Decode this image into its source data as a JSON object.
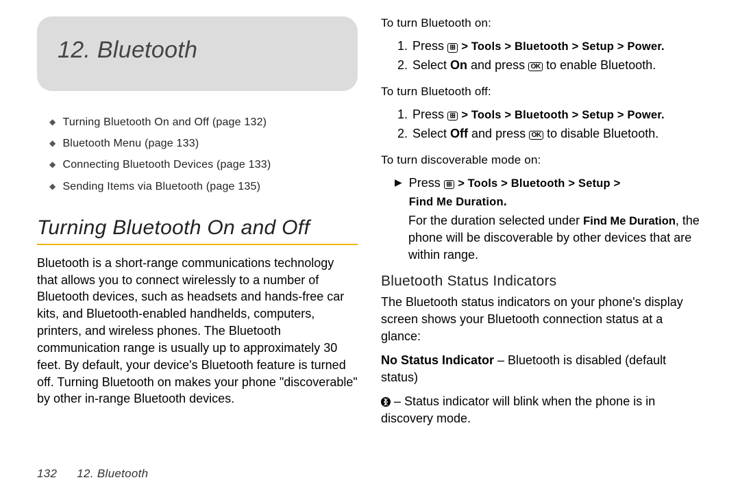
{
  "chapter": {
    "number": "12.",
    "title": "Bluetooth"
  },
  "toc": [
    "Turning Bluetooth On and Off (page 132)",
    "Bluetooth Menu (page 133)",
    "Connecting Bluetooth Devices (page 133)",
    "Sending Items via Bluetooth (page 135)"
  ],
  "section1": {
    "heading": "Turning Bluetooth On and Off",
    "intro": "Bluetooth is a short-range communications technology that allows you to connect wirelessly to a number of Bluetooth devices, such as headsets and hands-free car kits, and Bluetooth-enabled handhelds, computers, printers, and wireless phones. The Bluetooth communication range is usually up to approximately 30 feet. By default, your device's Bluetooth feature is turned off. Turning Bluetooth on makes your phone \"discoverable\" by other in-range Bluetooth devices."
  },
  "right": {
    "on_lead": "To turn Bluetooth on:",
    "on_step1_prefix": "Press ",
    "menu_glyph": "⊞",
    "ok_glyph": "OK",
    "path_power": " Tools > Bluetooth > Setup > Power.",
    "on_step2_a": "Select ",
    "on_step2_on": "On",
    "on_step2_b": " and press ",
    "on_step2_c": " to enable Bluetooth.",
    "off_lead": "To turn Bluetooth off:",
    "off_step2_a": "Select ",
    "off_step2_off": "Off",
    "off_step2_b": " and press ",
    "off_step2_c": " to disable Bluetooth.",
    "disc_lead": "To turn discoverable mode on:",
    "disc_step_prefix": "Press ",
    "path_setup_only_a": " Tools > Bluetooth > Setup >",
    "path_findme": "Find Me Duration",
    "disc_note_a": "For the duration selected under ",
    "disc_note_b": "Find Me Duration",
    "disc_note_c": ", the phone will be discoverable by other devices that are within range.",
    "sub_heading": "Bluetooth Status Indicators",
    "sub_intro": "The Bluetooth status indicators on your phone's display screen shows your Bluetooth connection status at a glance:",
    "nsi_label": "No Status Indicator",
    "nsi_text": " – Bluetooth is disabled (default status)",
    "blink_text": " – Status indicator will blink when the phone is in discovery mode."
  },
  "footer": {
    "page_number": "132",
    "running": "12. Bluetooth"
  }
}
